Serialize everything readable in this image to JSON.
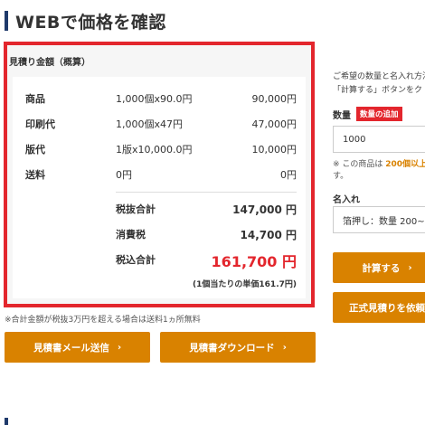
{
  "header": {
    "title": "WEBで価格を確認"
  },
  "estimate": {
    "heading": "見積り金額（概算）",
    "items": [
      {
        "label": "商品",
        "detail": "1,000個x90.0円",
        "amount": "90,000円"
      },
      {
        "label": "印刷代",
        "detail": "1,000個x47円",
        "amount": "47,000円"
      },
      {
        "label": "版代",
        "detail": "1版x10,000.0円",
        "amount": "10,000円"
      },
      {
        "label": "送料",
        "detail": "0円",
        "amount": "0円"
      }
    ],
    "subtotal": {
      "label": "税抜合計",
      "value": "147,000 円"
    },
    "tax": {
      "label": "消費税",
      "value": "14,700 円"
    },
    "total": {
      "label": "税込合計",
      "value": "161,700 円"
    },
    "unit_price": "(1個当たりの単価161.7円)"
  },
  "shipping_note": "※合計金額が税抜3万円を超える場合は送料1ヵ所無料",
  "actions": {
    "mail_label": "見積書メール送信",
    "download_label": "見積書ダウンロード",
    "calc_label": "計算する",
    "formal_label": "正式見積りを依頼",
    "chevron": "›"
  },
  "sidebar": {
    "instruction_line1": "ご希望の数量と名入れ方法",
    "instruction_line2": "「計算する」ボタンをク",
    "qty_label": "数量",
    "qty_badge": "数量の追加",
    "qty_value": "1000",
    "min_note_prefix": "※ この商品は",
    "min_note_highlight": "200個以上",
    "min_note_suffix": "す。",
    "name_label": "名入れ",
    "name_select": "箔押し：数量 200~"
  },
  "colors": {
    "accent": "#d98200",
    "alert": "#e3262d",
    "title_bar": "#1f3a6b"
  }
}
